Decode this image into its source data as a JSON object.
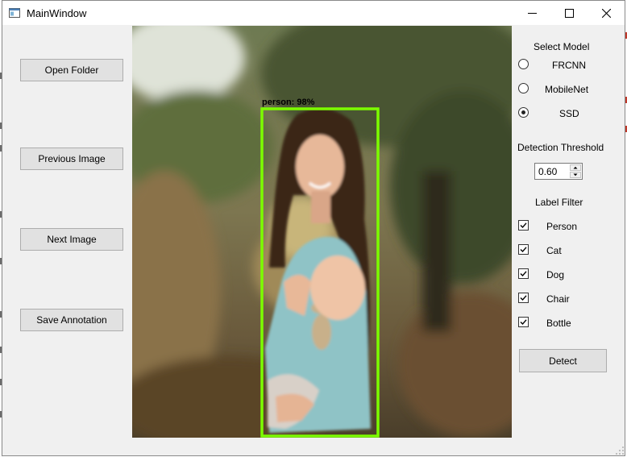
{
  "window": {
    "title": "MainWindow"
  },
  "left_panel": {
    "open_folder": "Open Folder",
    "previous_image": "Previous Image",
    "next_image": "Next Image",
    "save_annotation": "Save Annotation"
  },
  "detection": {
    "label": "person: 98%",
    "box_color": "#7cfc00"
  },
  "right_panel": {
    "select_model_label": "Select Model",
    "models": [
      {
        "label": "FRCNN",
        "selected": false
      },
      {
        "label": "MobileNet",
        "selected": false
      },
      {
        "label": "SSD",
        "selected": true
      }
    ],
    "threshold_label": "Detection Threshold",
    "threshold_value": "0.60",
    "label_filter_label": "Label Filter",
    "filters": [
      {
        "label": "Person",
        "checked": true
      },
      {
        "label": "Cat",
        "checked": true
      },
      {
        "label": "Dog",
        "checked": true
      },
      {
        "label": "Chair",
        "checked": true
      },
      {
        "label": "Bottle",
        "checked": true
      }
    ],
    "detect_button": "Detect"
  }
}
